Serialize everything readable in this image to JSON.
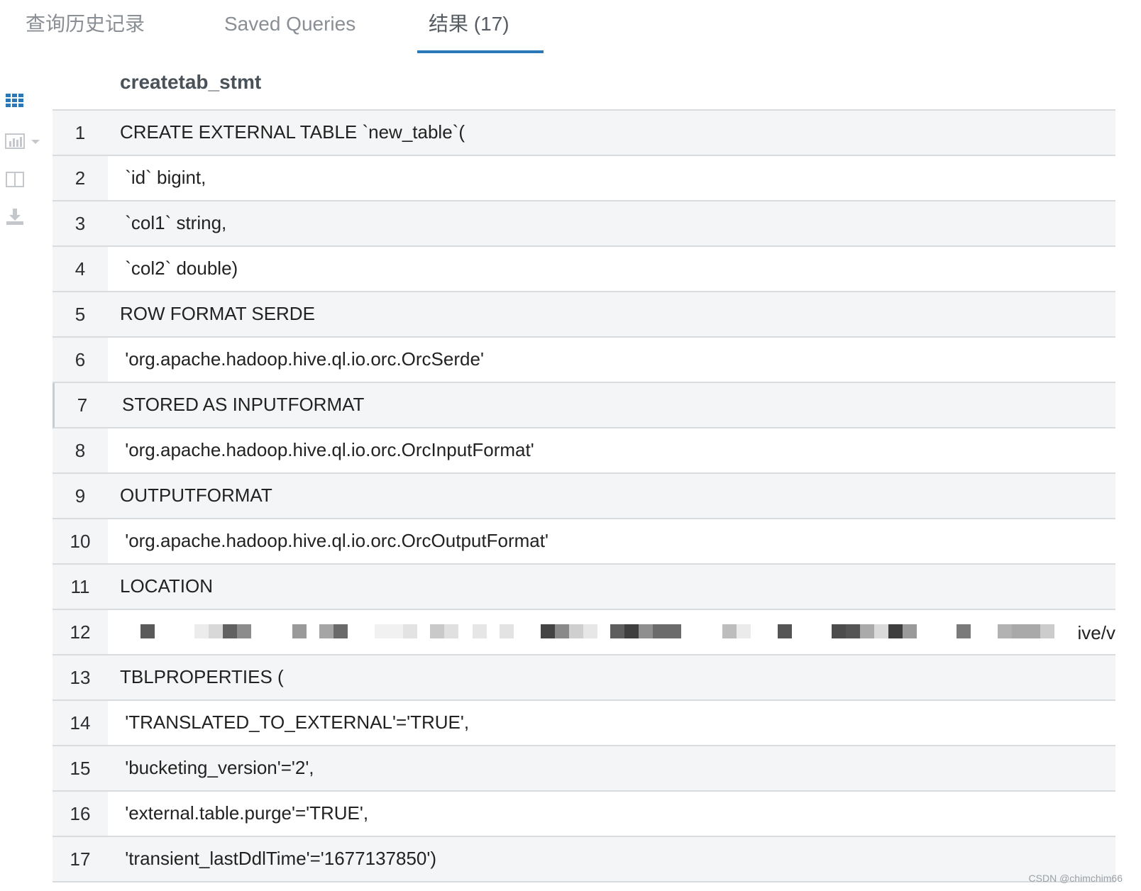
{
  "tabs": [
    {
      "label": "查询历史记录"
    },
    {
      "label": "Saved Queries"
    },
    {
      "label": "结果 (17)",
      "active": true
    }
  ],
  "toolbar": {
    "icons": [
      "grid-view-icon",
      "chart-icon",
      "chevron-down-icon",
      "columns-icon",
      "download-icon"
    ],
    "accent_color": "#2a78b8"
  },
  "table": {
    "column": "createtab_stmt",
    "rows": [
      {
        "num": "1",
        "value": "CREATE EXTERNAL TABLE `new_table`("
      },
      {
        "num": "2",
        "value": " `id` bigint,"
      },
      {
        "num": "3",
        "value": " `col1` string,"
      },
      {
        "num": "4",
        "value": " `col2` double)"
      },
      {
        "num": "5",
        "value": "ROW FORMAT SERDE"
      },
      {
        "num": "6",
        "value": " 'org.apache.hadoop.hive.ql.io.orc.OrcSerde'"
      },
      {
        "num": "7",
        "value": "STORED AS INPUTFORMAT"
      },
      {
        "num": "8",
        "value": " 'org.apache.hadoop.hive.ql.io.orc.OrcInputFormat'"
      },
      {
        "num": "9",
        "value": "OUTPUTFORMAT"
      },
      {
        "num": "10",
        "value": " 'org.apache.hadoop.hive.ql.io.orc.OrcOutputFormat'"
      },
      {
        "num": "11",
        "value": "LOCATION"
      },
      {
        "num": "12",
        "value": "ive/v"
      },
      {
        "num": "13",
        "value": "TBLPROPERTIES ("
      },
      {
        "num": "14",
        "value": " 'TRANSLATED_TO_EXTERNAL'='TRUE',"
      },
      {
        "num": "15",
        "value": " 'bucketing_version'='2',"
      },
      {
        "num": "16",
        "value": " 'external.table.purge'='TRUE',"
      },
      {
        "num": "17",
        "value": " 'transient_lastDdlTime'='1677137850')"
      }
    ]
  },
  "watermark": "CSDN @chimchim66"
}
